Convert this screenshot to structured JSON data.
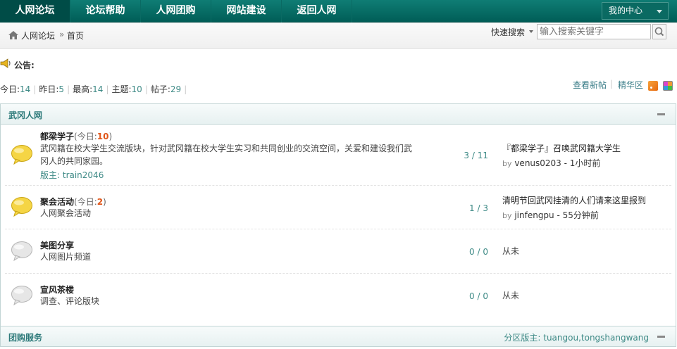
{
  "nav": {
    "items": [
      "人网论坛",
      "论坛帮助",
      "人网团购",
      "网站建设",
      "返回人网"
    ],
    "active_index": 0,
    "user_center": "我的中心"
  },
  "breadcrumb": {
    "home": "人网论坛",
    "separator": "»",
    "current": "首页"
  },
  "search": {
    "label": "快速搜索",
    "placeholder": "输入搜索关键字"
  },
  "announcement": {
    "label": "公告:"
  },
  "stats": {
    "today_label": "今日:",
    "today": "14",
    "yesterday_label": "昨日:",
    "yesterday": "5",
    "max_label": "最高:",
    "max": "14",
    "threads_label": "主题:",
    "threads": "10",
    "posts_label": "帖子:",
    "posts": "29",
    "sep": "|"
  },
  "links": {
    "new_posts": "查看新帖",
    "sep": "|",
    "digest": "精华区"
  },
  "categories": [
    {
      "title": "武冈人网",
      "forums": [
        {
          "name": "都梁学子",
          "today_prefix": "(今日:",
          "today_count": "10",
          "today_suffix": ")",
          "desc": "武冈籍在校大学生交流版块，针对武冈籍在校大学生实习和共同创业的交流空间，关爱和建设我们武冈人的共同家园。",
          "moderator": "版主: train2046",
          "counts": "3 / 11",
          "last_title": "『都梁学子』召唤武冈籍大学生",
          "last_by": "by",
          "last_user": "venus0203",
          "last_time": "- 1小时前",
          "has_new": true
        },
        {
          "name": "聚会活动",
          "today_prefix": "(今日:",
          "today_count": "2",
          "today_suffix": ")",
          "desc": "人网聚会活动",
          "counts": "1 / 3",
          "last_title": "清明节回武冈挂清的人们请来这里报到",
          "last_by": "by",
          "last_user": "jinfengpu",
          "last_time": "- 55分钟前",
          "has_new": true
        },
        {
          "name": "美图分享",
          "desc": "人网图片频道",
          "counts": "0 / 0",
          "last_never": "从未",
          "has_new": false
        },
        {
          "name": "宣风茶楼",
          "desc": "调查、评论版块",
          "counts": "0 / 0",
          "last_never": "从未",
          "has_new": false
        }
      ]
    },
    {
      "title": "团购服务",
      "moderators": "分区版主: tuangou,tongshangwang"
    }
  ],
  "colors": {
    "nav_bg": "#00665f",
    "accent_text": "#3e8a86",
    "today_count": "#e0561a",
    "category_title": "#2d7a7a",
    "bubble_new": "#f5d545",
    "bubble_old": "#dcdcdc"
  },
  "icons": [
    "home-icon",
    "search-icon",
    "announcement-icon",
    "rss-icon",
    "color-icon",
    "forum-new-icon",
    "forum-old-icon",
    "collapse-icon",
    "chevron-down-icon"
  ]
}
